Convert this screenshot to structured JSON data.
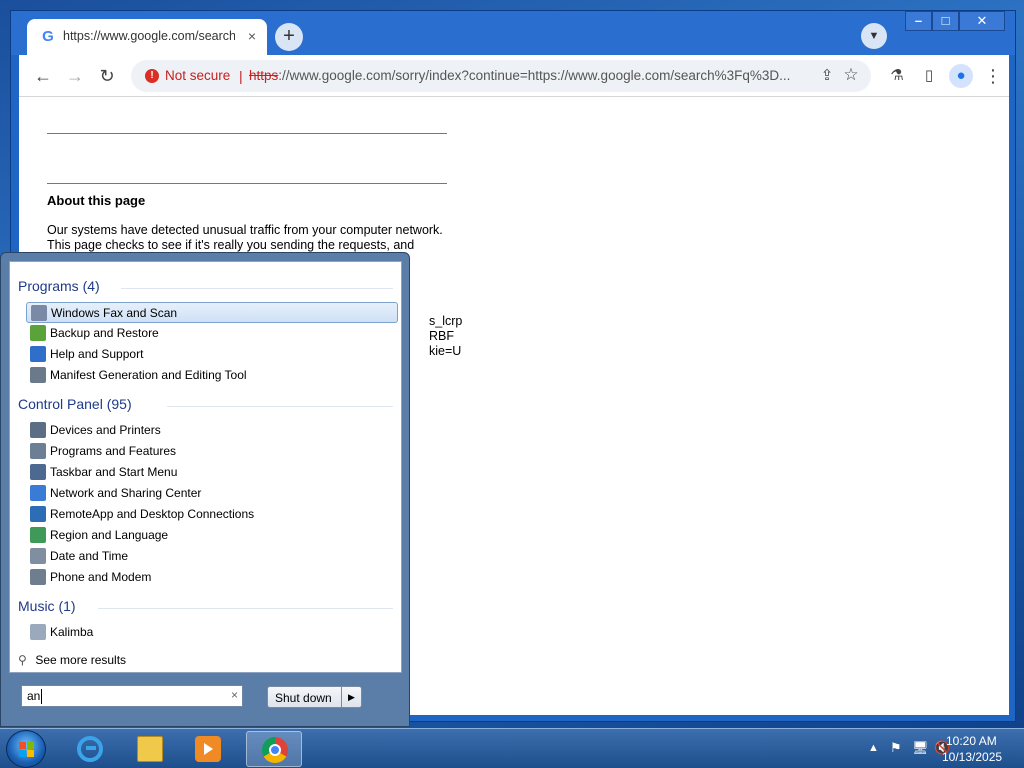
{
  "browser": {
    "tab_title": "https://www.google.com/search",
    "favicon": "G",
    "tab_close": "×",
    "new_tab": "+",
    "omnibox": {
      "security_label": "Not secure",
      "separator": "|",
      "url_scheme": "https",
      "url_rest": "://www.google.com/sorry/index?continue=https://www.google.com/search%3Fq%3D..."
    }
  },
  "page": {
    "about_title": "About this page",
    "about_text": "Our systems have detected unusual traffic from your computer network. This page checks to see if it's really you sending the requests, and",
    "partial_right_text": "s_lcrp\nRBF\nkie=U"
  },
  "start_menu": {
    "groups": [
      {
        "title": "Programs (4)",
        "items": [
          {
            "label": "Windows Fax and Scan",
            "icon": "fax-icon",
            "selected": true
          },
          {
            "label": "Backup and Restore",
            "icon": "backup-icon"
          },
          {
            "label": "Help and Support",
            "icon": "help-icon"
          },
          {
            "label": "Manifest Generation and Editing Tool",
            "icon": "manifest-tool-icon"
          }
        ]
      },
      {
        "title": "Control Panel (95)",
        "items": [
          {
            "label": "Devices and Printers",
            "icon": "printer-icon"
          },
          {
            "label": "Programs and Features",
            "icon": "programs-icon"
          },
          {
            "label": "Taskbar and Start Menu",
            "icon": "taskbar-icon"
          },
          {
            "label": "Network and Sharing Center",
            "icon": "network-icon"
          },
          {
            "label": "RemoteApp and Desktop Connections",
            "icon": "remoteapp-icon"
          },
          {
            "label": "Region and Language",
            "icon": "globe-icon"
          },
          {
            "label": "Date and Time",
            "icon": "clock-icon"
          },
          {
            "label": "Phone and Modem",
            "icon": "phone-icon"
          }
        ]
      },
      {
        "title": "Music (1)",
        "items": [
          {
            "label": "Kalimba",
            "icon": "music-note-icon"
          }
        ]
      }
    ],
    "see_more": "See more results",
    "search_value": "an",
    "search_clear": "×",
    "shutdown_label": "Shut down"
  },
  "taskbar": {
    "apps": [
      {
        "name": "internet-explorer",
        "icon": "ie-icon"
      },
      {
        "name": "file-explorer",
        "icon": "folder-icon"
      },
      {
        "name": "media-player",
        "icon": "media-player-icon"
      },
      {
        "name": "chrome",
        "icon": "chrome-icon",
        "active": true
      }
    ],
    "clock_time": "10:20 AM",
    "clock_date": "10/13/2025"
  },
  "colors": {
    "accent": "#1f65c4",
    "not_secure": "#c5221f",
    "taskbar": "#2a5a9a"
  }
}
